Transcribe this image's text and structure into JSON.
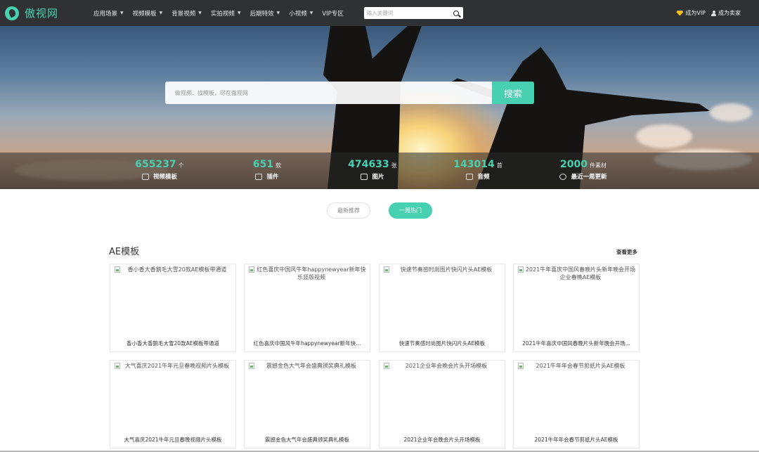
{
  "nav": {
    "logo_text": "傲视网",
    "menu": [
      {
        "label": "应用场景"
      },
      {
        "label": "视频模板"
      },
      {
        "label": "背景视频"
      },
      {
        "label": "实拍视频"
      },
      {
        "label": "后期特效"
      },
      {
        "label": "小视频"
      },
      {
        "label": "VIP专区"
      }
    ],
    "search_placeholder": "输入关键词",
    "vip_label": "成为VIP",
    "author_label": "成为卖家"
  },
  "hero": {
    "search_placeholder": "做视频、找模板，尽在傲视网",
    "search_button": "搜索",
    "stats": [
      {
        "number": "655237",
        "unit": "个",
        "label": "视频模板",
        "icon": "video-icon"
      },
      {
        "number": "651",
        "unit": "款",
        "label": "插件",
        "icon": "puzzle-icon"
      },
      {
        "number": "474633",
        "unit": "张",
        "label": "图片",
        "icon": "image-icon"
      },
      {
        "number": "143014",
        "unit": "首",
        "label": "音频",
        "icon": "music-icon"
      },
      {
        "number": "2000",
        "unit": "件素材",
        "label": "最近一周更新",
        "icon": "clock-icon"
      }
    ]
  },
  "tabs": [
    {
      "label": "最新推荐",
      "active": false
    },
    {
      "label": "一周热门",
      "active": true
    }
  ],
  "section": {
    "title": "AE模板",
    "more_label": "查看更多",
    "cards": [
      {
        "alt": "香小香大香鹅毛大雪20款AE模板带通道",
        "title": "香小香大香鹅毛大雪20款AE模板带通道"
      },
      {
        "alt": "红色喜庆中国风牛年happynewyear新年快乐竖版视频",
        "title": "红色喜庆中国风牛年happynewyear新年快..."
      },
      {
        "alt": "快速节奏感时尚图片快闪片头AE模板",
        "title": "快速节奏感时尚图片快闪片头AE模板"
      },
      {
        "alt": "2021牛年喜庆中国风春晚片头新年晚会开场企业春晚AE模板",
        "title": "2021牛年喜庆中国风春晚片头新年晚会开场..."
      },
      {
        "alt": "大气喜庆2021牛年元旦春晚视频片头模板",
        "title": "大气喜庆2021牛年元旦春晚视频片头模板"
      },
      {
        "alt": "震撼金色大气年会盛典颁奖典礼模板",
        "title": "震撼金色大气年会盛典颁奖典礼模板"
      },
      {
        "alt": "2021企业年会晚会片头开场模板",
        "title": "2021企业年会晚会片头开场模板"
      },
      {
        "alt": "2021牛年年会春节剪纸片头AE模板",
        "title": "2021牛年年会春节剪纸片头AE模板"
      }
    ]
  },
  "colors": {
    "accent": "#47d1b1",
    "nav_bg": "#2f3133",
    "vip": "#f2c21a"
  }
}
